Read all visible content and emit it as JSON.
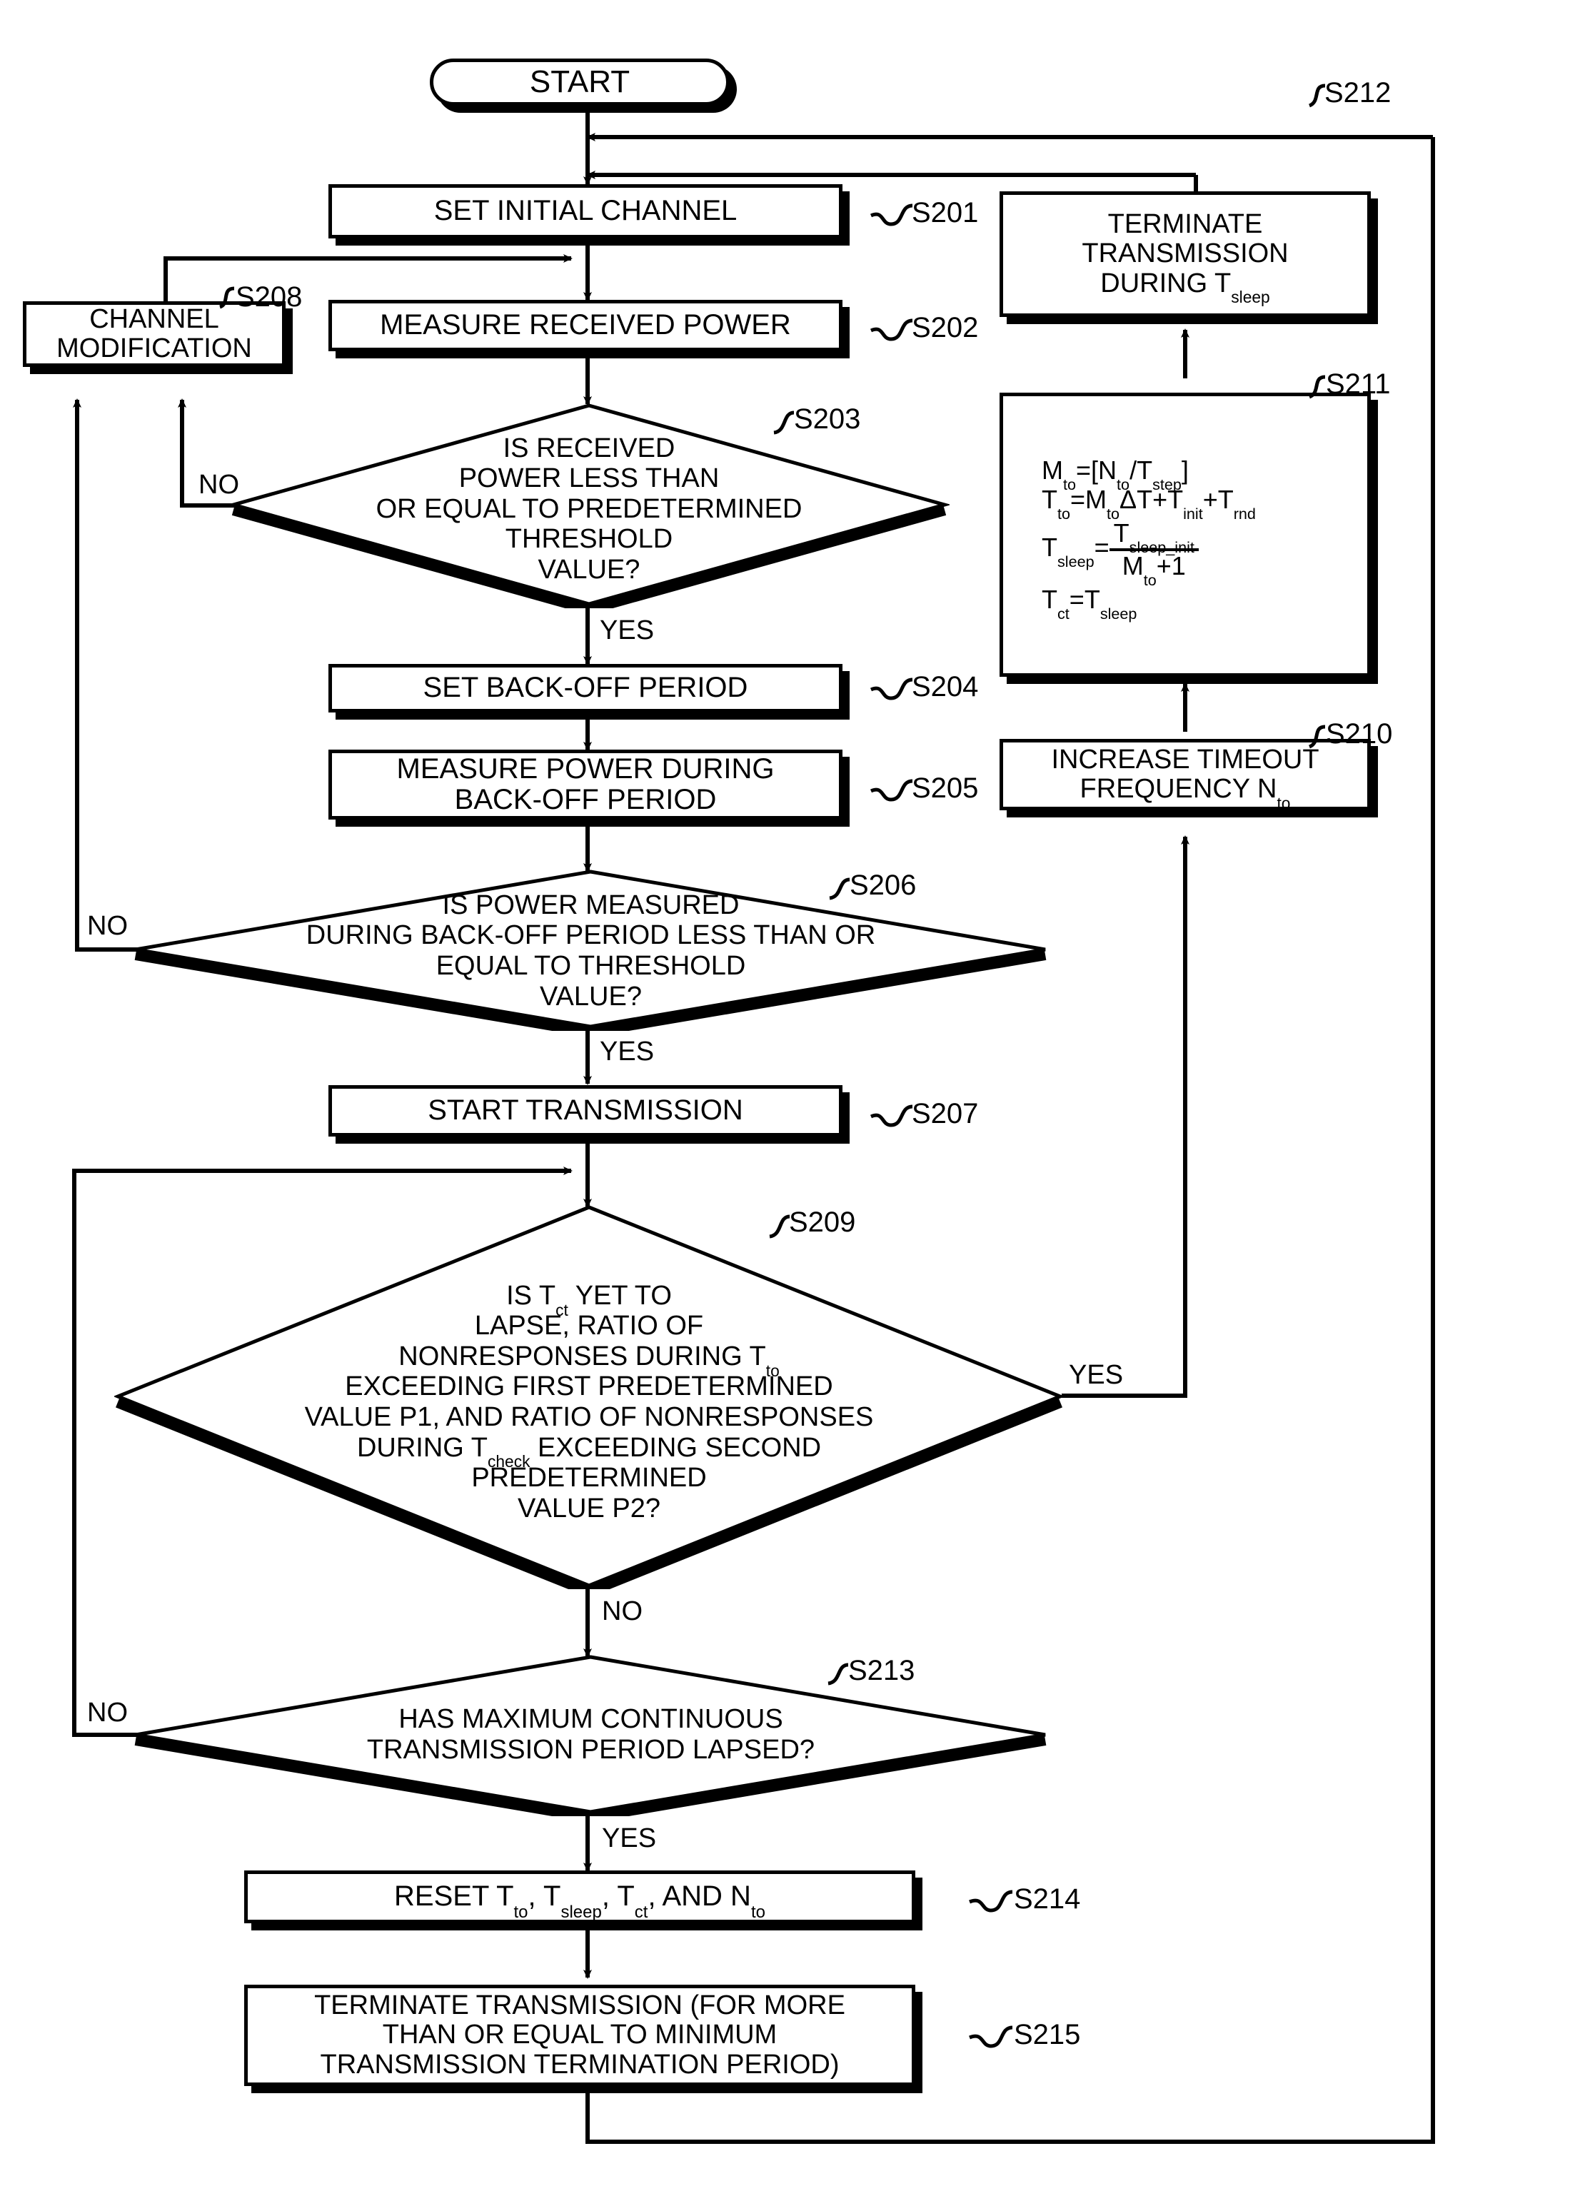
{
  "figure": {
    "type": "patent-flowchart",
    "start_label": "START"
  },
  "nodes": {
    "start": {
      "label": "START"
    },
    "s201": {
      "label": "SET INITIAL CHANNEL",
      "step": "S201"
    },
    "s202": {
      "label": "MEASURE RECEIVED POWER",
      "step": "S202"
    },
    "s208": {
      "line1": "CHANNEL",
      "line2": "MODIFICATION",
      "step": "S208"
    },
    "s203": {
      "line1": "IS RECEIVED",
      "line2": "POWER LESS THAN",
      "line3": "OR EQUAL TO PREDETERMINED",
      "line4": "THRESHOLD",
      "line5": "VALUE?",
      "step": "S203",
      "yes": "YES",
      "no": "NO"
    },
    "s204": {
      "label": "SET BACK-OFF PERIOD",
      "step": "S204"
    },
    "s205": {
      "line1": "MEASURE POWER DURING",
      "line2": "BACK-OFF PERIOD",
      "step": "S205"
    },
    "s206": {
      "line1": "IS POWER MEASURED",
      "line2": "DURING BACK-OFF PERIOD LESS THAN OR",
      "line3": "EQUAL TO THRESHOLD",
      "line4": "VALUE?",
      "step": "S206",
      "yes": "YES",
      "no": "NO"
    },
    "s207": {
      "label": "START TRANSMISSION",
      "step": "S207"
    },
    "s209": {
      "line1a": "IS T",
      "line1b": "ct",
      "line1c": " YET TO",
      "line2": "LAPSE, RATIO OF",
      "line3a": "NONRESPONSES DURING T",
      "line3b": "to",
      "line4": "EXCEEDING FIRST PREDETERMINED",
      "line5": "VALUE P1, AND RATIO OF NONRESPONSES",
      "line6a": "DURING T",
      "line6b": "check",
      "line6c": " EXCEEDING SECOND",
      "line7": "PREDETERMINED",
      "line8": "VALUE P2?",
      "step": "S209",
      "yes": "YES",
      "no": "NO"
    },
    "s210": {
      "line1": "INCREASE TIMEOUT",
      "line2a": "FREQUENCY N",
      "line2b": "to",
      "step": "S210"
    },
    "s211": {
      "step": "S211",
      "eq1": "M",
      "eq1sub": "to",
      "eq1rest": "=[N",
      "eq1sub2": "to",
      "eq1rest2": "/T",
      "eq1sub3": "step",
      "eq1rest3": "]",
      "eq2a": "T",
      "eq2asub": "to",
      "eq2b": "=M",
      "eq2bsub": "to",
      "eq2c": "ΔT+T",
      "eq2csub": "init",
      "eq2d": "+T",
      "eq2dsub": "rnd",
      "eq3a": "T",
      "eq3asub": "sleep",
      "eq3b": "=",
      "eq3num": "T",
      "eq3numsub": "sleep_init",
      "eq3den": "M",
      "eq3densub": "to",
      "eq3den2": "+1",
      "eq4a": "T",
      "eq4asub": "ct",
      "eq4b": "=T",
      "eq4bsub": "sleep"
    },
    "s212": {
      "line1": "TERMINATE",
      "line2": "TRANSMISSION",
      "line3a": "DURING T",
      "line3b": "sleep",
      "step": "S212"
    },
    "s213": {
      "line1": "HAS MAXIMUM CONTINUOUS",
      "line2": "TRANSMISSION PERIOD LAPSED?",
      "step": "S213",
      "yes": "YES",
      "no": "NO"
    },
    "s214": {
      "a": "RESET T",
      "asub": "to",
      "b": ", T",
      "bsub": "sleep",
      "c": ", T",
      "csub": "ct",
      "d": ", AND N",
      "dsub": "to",
      "step": "S214"
    },
    "s215": {
      "line1": "TERMINATE TRANSMISSION (FOR MORE",
      "line2": "THAN OR EQUAL TO MINIMUM",
      "line3": "TRANSMISSION TERMINATION PERIOD)",
      "step": "S215"
    }
  },
  "edge_labels": {
    "s203_no": "NO",
    "s203_yes": "YES",
    "s206_no": "NO",
    "s206_yes": "YES",
    "s209_yes": "YES",
    "s209_no": "NO",
    "s213_no": "NO",
    "s213_yes": "YES"
  },
  "colors": {
    "ink": "#000000",
    "paper": "#ffffff"
  }
}
